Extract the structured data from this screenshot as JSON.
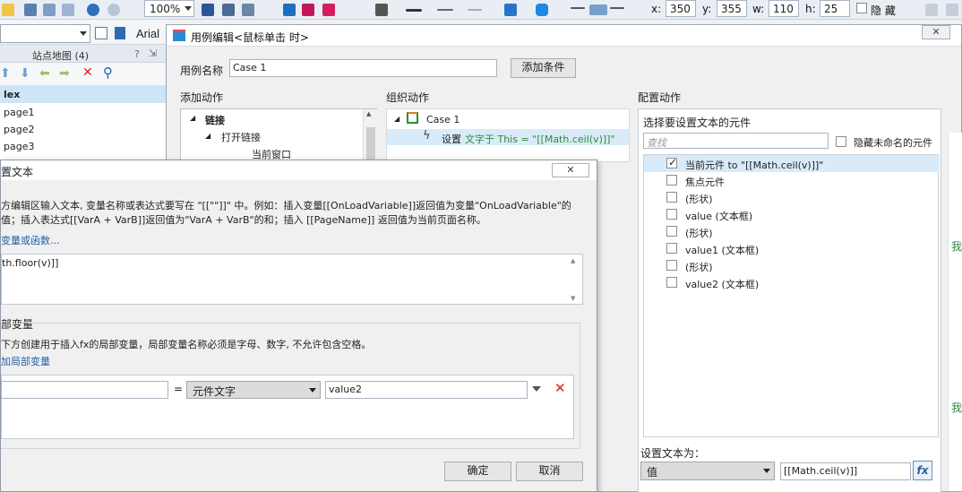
{
  "toolbar": {
    "zoom": "100%",
    "x_label": "x:",
    "x_value": "350",
    "y_label": "y:",
    "y_value": "355",
    "w_label": "w:",
    "w_value": "110",
    "h_label": "h:",
    "h_value": "25",
    "hide_label": "隐 藏"
  },
  "font_name": "Arial",
  "sitemap": {
    "title": "站点地图 (4)",
    "help": "?",
    "pages": [
      "lex",
      "page1",
      "page2",
      "page3"
    ]
  },
  "case_editor": {
    "title": "用例编辑<鼠标单击 时>",
    "case_name_label": "用例名称",
    "case_name_value": "Case 1",
    "add_condition": "添加条件",
    "add_action_label": "添加动作",
    "organize_label": "组织动作",
    "configure_label": "配置动作",
    "actions_tree": {
      "links": "链接",
      "open_link": "打开链接",
      "current_window": "当前窗口"
    },
    "org_tree": {
      "case": "Case 1",
      "action_prefix": "设置 ",
      "action_mid": "文字于 This = \"[[Math.ceil(v)]]\""
    },
    "select_elements_label": "选择要设置文本的元件",
    "search_placeholder": "查找",
    "hide_unnamed_label": "隐藏未命名的元件",
    "elements": [
      {
        "label": "当前元件 to \"[[Math.ceil(v)]]\"",
        "checked": true
      },
      {
        "label": "焦点元件",
        "checked": false
      },
      {
        "label": "(形状)",
        "checked": false
      },
      {
        "label": "value (文本框)",
        "checked": false
      },
      {
        "label": "(形状)",
        "checked": false
      },
      {
        "label": "value1 (文本框)",
        "checked": false
      },
      {
        "label": "(形状)",
        "checked": false
      },
      {
        "label": "value2 (文本框)",
        "checked": false
      }
    ],
    "set_text_label": "设置文本为：",
    "set_text_type": "值",
    "set_text_value": "[[Math.ceil(v)]]",
    "fx": "fx",
    "right_edge_chars": [
      "我",
      "我"
    ]
  },
  "set_text_dialog": {
    "title": "置文本",
    "desc_line1": "方编辑区输入文本, 变量名称或表达式要写在 \"[[\"\"]]\" 中。例如：插入变量[[OnLoadVariable]]返回值为变量\"OnLoadVariable\"的",
    "desc_line2": "值；插入表达式[[VarA + VarB]]返回值为\"VarA + VarB\"的和；插入 [[PageName]] 返回值为当前页面名称。",
    "insert_link": "变量或函数...",
    "expression": "th.floor(v)]]",
    "local_vars_title": "部变量",
    "local_vars_desc": "下方创建用于插入fx的局部变量，局部变量名称必须是字母、数字, 不允许包含空格。",
    "add_local_var": "加局部变量",
    "var_equals": "=",
    "var_type": "元件文字",
    "var_target": "value2",
    "ok": "确定",
    "cancel": "取消"
  },
  "colors": {
    "selection_blue": "#cde6f7",
    "link_blue": "#1f5fa8",
    "action_green": "#2e8b3e",
    "delete_red": "#d81e1e"
  }
}
